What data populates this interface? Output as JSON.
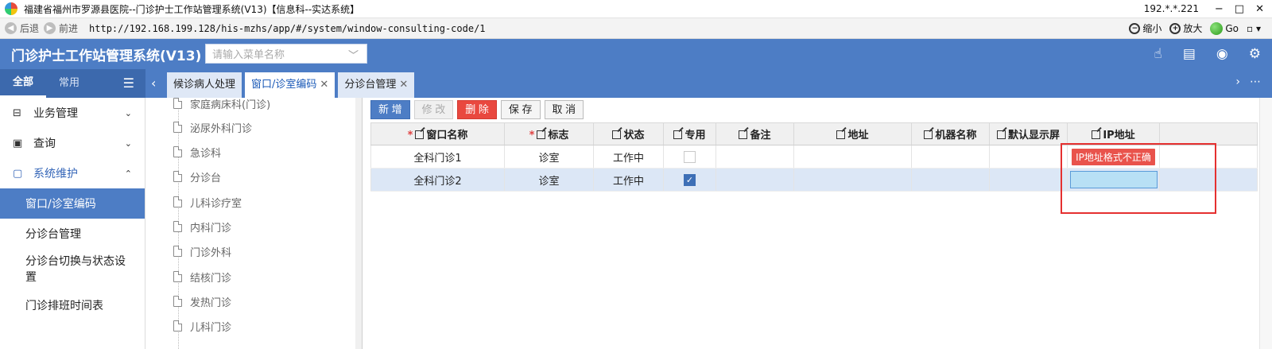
{
  "window": {
    "title": "福建省福州市罗源县医院--门诊护士工作站管理系统(V13)【信息科--实达系统】",
    "ip": "192.*.*.221",
    "controls": [
      "−",
      "□",
      "✕"
    ]
  },
  "browser": {
    "back_label": "后退",
    "forward_label": "前进",
    "url": "http://192.168.199.128/his-mzhs/app/#/system/window-consulting-code/1",
    "zoom_out_label": "缩小",
    "zoom_in_label": "放大",
    "go_label": "Go"
  },
  "header": {
    "app_title": "门诊护士工作站管理系统(V13)",
    "menu_search_placeholder": "请输入菜单名称"
  },
  "side_tabs": {
    "all": "全部",
    "common": "常用"
  },
  "page_tabs": [
    {
      "label": "候诊病人处理",
      "closable": false,
      "active": false
    },
    {
      "label": "窗口/诊室编码",
      "closable": true,
      "active": true
    },
    {
      "label": "分诊台管理",
      "closable": true,
      "active": false
    }
  ],
  "sidebar": {
    "groups": [
      {
        "label": "业务管理",
        "icon": "briefcase-icon",
        "open": false
      },
      {
        "label": "查询",
        "icon": "document-icon",
        "open": false
      },
      {
        "label": "系统维护",
        "icon": "monitor-icon",
        "open": true
      }
    ],
    "items": [
      {
        "label": "窗口/诊室编码",
        "active": true
      },
      {
        "label": "分诊台管理",
        "active": false
      },
      {
        "label": "分诊台切换与状态设置",
        "active": false
      },
      {
        "label": "门诊排班时间表",
        "active": false
      }
    ]
  },
  "tree": {
    "nodes": [
      "家庭病床科(门诊)",
      "泌尿外科门诊",
      "急诊科",
      "分诊台",
      "儿科诊疗室",
      "内科门诊",
      "门诊外科",
      "结核门诊",
      "发热门诊",
      "儿科门诊"
    ]
  },
  "toolbar": {
    "new": "新 增",
    "edit": "修 改",
    "delete": "删 除",
    "save": "保 存",
    "cancel": "取 消"
  },
  "grid": {
    "columns": [
      {
        "label": "窗口名称",
        "required": true
      },
      {
        "label": "标志",
        "required": true
      },
      {
        "label": "状态",
        "required": false
      },
      {
        "label": "专用",
        "required": false
      },
      {
        "label": "备注",
        "required": false
      },
      {
        "label": "地址",
        "required": false
      },
      {
        "label": "机器名称",
        "required": false
      },
      {
        "label": "默认显示屏",
        "required": false
      },
      {
        "label": "IP地址",
        "required": false
      }
    ],
    "rows": [
      {
        "name": "全科门诊1",
        "flag": "诊室",
        "status": "工作中",
        "dedicated": false,
        "ip_error": "IP地址格式不正确",
        "selected": false
      },
      {
        "name": "全科门诊2",
        "flag": "诊室",
        "status": "工作中",
        "dedicated": true,
        "ip_error": "",
        "selected": true
      }
    ]
  },
  "colors": {
    "primary": "#4d7dc5",
    "danger": "#e9483f",
    "highlight_box": "#e53030"
  }
}
